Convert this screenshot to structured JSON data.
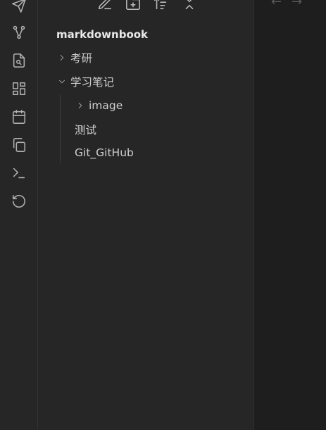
{
  "ribbon": {
    "items": [
      {
        "icon": "send-icon"
      },
      {
        "icon": "graph-view-icon"
      },
      {
        "icon": "file-search-icon"
      },
      {
        "icon": "layout-dashboard-icon"
      },
      {
        "icon": "calendar-icon"
      },
      {
        "icon": "copy-files-icon"
      },
      {
        "icon": "terminal-icon"
      },
      {
        "icon": "history-reset-icon"
      }
    ]
  },
  "sidebar": {
    "nav_buttons": [
      {
        "icon": "new-note-icon"
      },
      {
        "icon": "new-folder-icon"
      },
      {
        "icon": "sort-icon"
      },
      {
        "icon": "collapse-all-icon"
      }
    ],
    "vault_name": "markdownbook",
    "tree": {
      "folder_kaoyan": "考研",
      "folder_notes": "学习笔记",
      "folder_image": "image",
      "file_test": "测试",
      "file_git": "Git_GitHub"
    }
  },
  "main": {
    "back_symbol": "←",
    "forward_symbol": "→"
  }
}
